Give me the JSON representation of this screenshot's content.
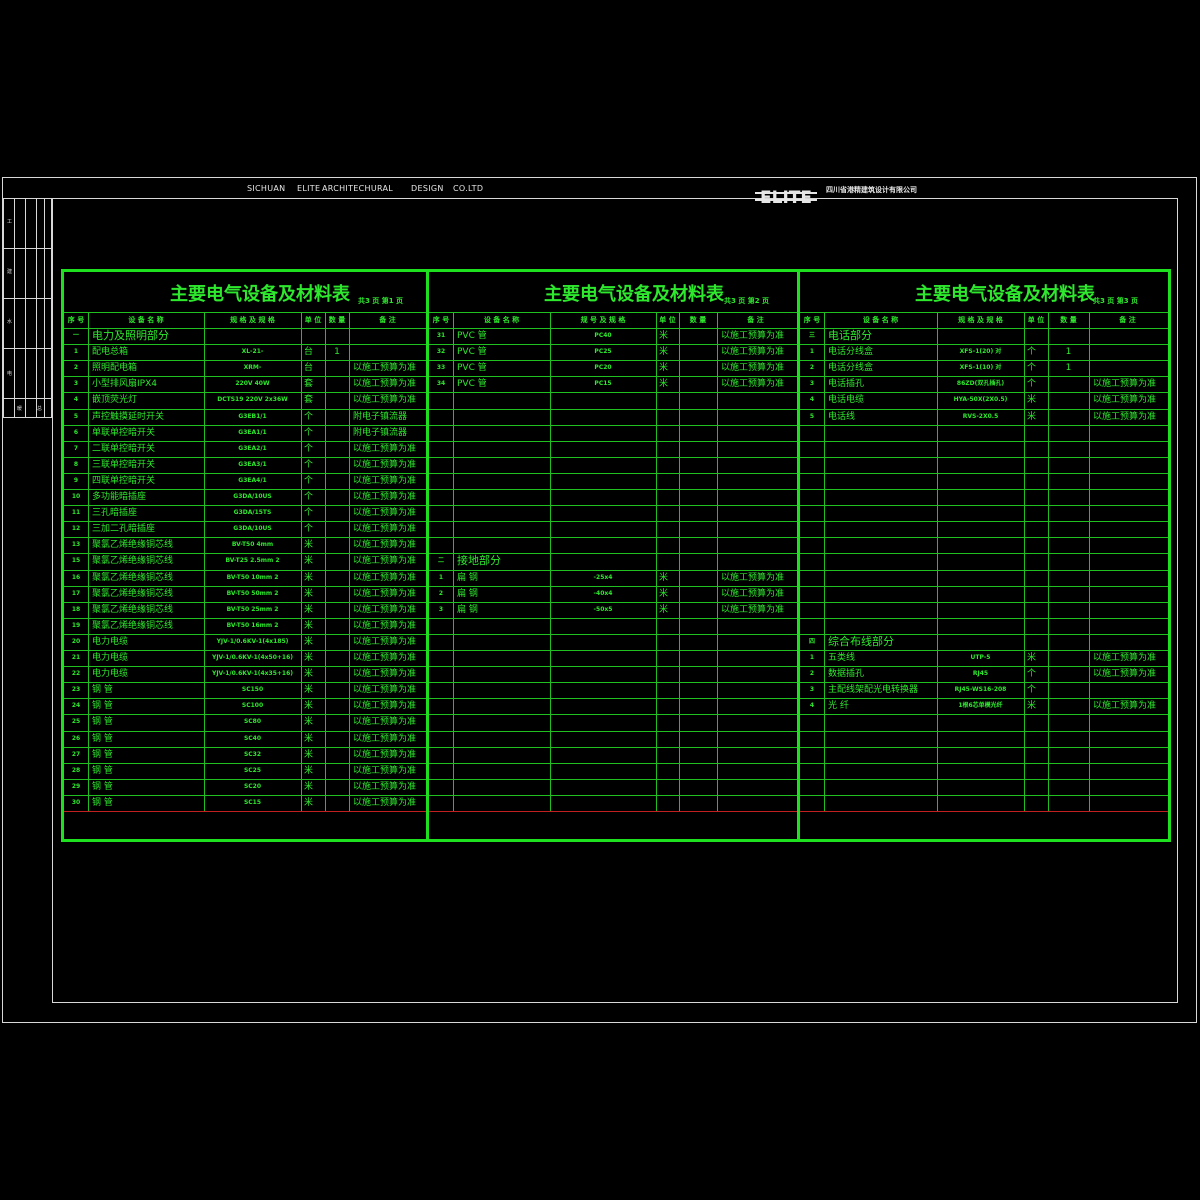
{
  "header": {
    "sichuan": "SICHUAN",
    "elite": "ELITE",
    "arch": "ARCHITECHURAL",
    "design": "DESIGN",
    "coltd": "CO.LTD",
    "logo": "ELITE",
    "company": "四川省港精建筑设计有限公司"
  },
  "strip_labels": [
    "工",
    "建",
    "水",
    "电",
    "暖",
    "总"
  ],
  "headers": {
    "seq": "序 号",
    "name": "设 备 名 称",
    "spec": "规 格 及 规 格",
    "unit": "单 位",
    "qty": "数 量",
    "note": "备 注",
    "spec2": "规 号 及 规 格"
  },
  "panels": [
    {
      "title": "主要电气设备及材料表",
      "page": "共3 页  第1 页",
      "rows": [
        [
          "一",
          "电力及照明部分",
          "",
          "",
          "",
          ""
        ],
        [
          "1",
          "配电总箱",
          "XL-21-",
          "台",
          "1",
          ""
        ],
        [
          "2",
          "照明配电箱",
          "XRM-",
          "台",
          "",
          "以施工预算为准"
        ],
        [
          "3",
          "小型排风扇IPX4",
          "220V 40W",
          "套",
          "",
          "以施工预算为准"
        ],
        [
          "4",
          "嵌顶荧光灯",
          "DCTS19 220V 2x36W",
          "套",
          "",
          "以施工预算为准"
        ],
        [
          "5",
          "声控触摸延时开关",
          "G3EB1/1",
          "个",
          "",
          "附电子镇流器"
        ],
        [
          "6",
          "单联单控暗开关",
          "G3EA1/1",
          "个",
          "",
          "附电子镇流器"
        ],
        [
          "7",
          "二联单控暗开关",
          "G3EA2/1",
          "个",
          "",
          "以施工预算为准"
        ],
        [
          "8",
          "三联单控暗开关",
          "G3EA3/1",
          "个",
          "",
          "以施工预算为准"
        ],
        [
          "9",
          "四联单控暗开关",
          "G3EA4/1",
          "个",
          "",
          "以施工预算为准"
        ],
        [
          "10",
          "多功能暗插座",
          "G3DA/10US",
          "个",
          "",
          "以施工预算为准"
        ],
        [
          "11",
          "三孔暗插座",
          "G3DA/15TS",
          "个",
          "",
          "以施工预算为准"
        ],
        [
          "12",
          "三加二孔暗插座",
          "G3DA/10US",
          "个",
          "",
          "以施工预算为准"
        ],
        [
          "13",
          "聚氯乙烯绝缘铜芯线",
          "BV-T50 4mm",
          "米",
          "",
          "以施工预算为准"
        ],
        [
          "15",
          "聚氯乙烯绝缘铜芯线",
          "BV-T25 2.5mm 2",
          "米",
          "",
          "以施工预算为准"
        ],
        [
          "16",
          "聚氯乙烯绝缘铜芯线",
          "BV-T50 10mm 2",
          "米",
          "",
          "以施工预算为准"
        ],
        [
          "17",
          "聚氯乙烯绝缘铜芯线",
          "BV-T50 50mm 2",
          "米",
          "",
          "以施工预算为准"
        ],
        [
          "18",
          "聚氯乙烯绝缘铜芯线",
          "BV-T50 25mm 2",
          "米",
          "",
          "以施工预算为准"
        ],
        [
          "19",
          "聚氯乙烯绝缘铜芯线",
          "BV-T50 16mm 2",
          "米",
          "",
          "以施工预算为准"
        ],
        [
          "20",
          "电力电缆",
          "YJV-1/0.6KV-1(4x185)",
          "米",
          "",
          "以施工预算为准"
        ],
        [
          "21",
          "电力电缆",
          "YJV-1/0.6KV-1(4x50+16)",
          "米",
          "",
          "以施工预算为准"
        ],
        [
          "22",
          "电力电缆",
          "YJV-1/0.6KV-1(4x35+16)",
          "米",
          "",
          "以施工预算为准"
        ],
        [
          "23",
          "钢 管",
          "SC150",
          "米",
          "",
          "以施工预算为准"
        ],
        [
          "24",
          "钢 管",
          "SC100",
          "米",
          "",
          "以施工预算为准"
        ],
        [
          "25",
          "钢 管",
          "SC80",
          "米",
          "",
          "以施工预算为准"
        ],
        [
          "26",
          "钢 管",
          "SC40",
          "米",
          "",
          "以施工预算为准"
        ],
        [
          "27",
          "钢 管",
          "SC32",
          "米",
          "",
          "以施工预算为准"
        ],
        [
          "28",
          "钢 管",
          "SC25",
          "米",
          "",
          "以施工预算为准"
        ],
        [
          "29",
          "钢 管",
          "SC20",
          "米",
          "",
          "以施工预算为准"
        ],
        [
          "30",
          "钢 管",
          "SC15",
          "米",
          "",
          "以施工预算为准"
        ]
      ]
    },
    {
      "title": "主要电气设备及材料表",
      "page": "共3 页  第2 页",
      "rows": [
        [
          "31",
          "PVC 管",
          "PC40",
          "米",
          "",
          "以施工预算为准"
        ],
        [
          "32",
          "PVC 管",
          "PC25",
          "米",
          "",
          "以施工预算为准"
        ],
        [
          "33",
          "PVC 管",
          "PC20",
          "米",
          "",
          "以施工预算为准"
        ],
        [
          "34",
          "PVC 管",
          "PC15",
          "米",
          "",
          "以施工预算为准"
        ],
        [
          "",
          "",
          "",
          "",
          "",
          ""
        ],
        [
          "",
          "",
          "",
          "",
          "",
          ""
        ],
        [
          "",
          "",
          "",
          "",
          "",
          ""
        ],
        [
          "",
          "",
          "",
          "",
          "",
          ""
        ],
        [
          "",
          "",
          "",
          "",
          "",
          ""
        ],
        [
          "",
          "",
          "",
          "",
          "",
          ""
        ],
        [
          "",
          "",
          "",
          "",
          "",
          ""
        ],
        [
          "",
          "",
          "",
          "",
          "",
          ""
        ],
        [
          "",
          "",
          "",
          "",
          "",
          ""
        ],
        [
          "",
          "",
          "",
          "",
          "",
          ""
        ],
        [
          "二",
          "接地部分",
          "",
          "",
          "",
          ""
        ],
        [
          "1",
          "扁 钢",
          "-25x4",
          "米",
          "",
          "以施工预算为准"
        ],
        [
          "2",
          "扁 钢",
          "-40x4",
          "米",
          "",
          "以施工预算为准"
        ],
        [
          "3",
          "扁 钢",
          "-50x5",
          "米",
          "",
          "以施工预算为准"
        ],
        [
          "",
          "",
          "",
          "",
          "",
          ""
        ],
        [
          "",
          "",
          "",
          "",
          "",
          ""
        ],
        [
          "",
          "",
          "",
          "",
          "",
          ""
        ],
        [
          "",
          "",
          "",
          "",
          "",
          ""
        ],
        [
          "",
          "",
          "",
          "",
          "",
          ""
        ],
        [
          "",
          "",
          "",
          "",
          "",
          ""
        ],
        [
          "",
          "",
          "",
          "",
          "",
          ""
        ],
        [
          "",
          "",
          "",
          "",
          "",
          ""
        ],
        [
          "",
          "",
          "",
          "",
          "",
          ""
        ],
        [
          "",
          "",
          "",
          "",
          "",
          ""
        ],
        [
          "",
          "",
          "",
          "",
          "",
          ""
        ],
        [
          "",
          "",
          "",
          "",
          "",
          ""
        ]
      ]
    },
    {
      "title": "主要电气设备及材料表",
      "page": "共3 页  第3 页",
      "rows": [
        [
          "三",
          "电话部分",
          "",
          "",
          "",
          ""
        ],
        [
          "1",
          "电话分线盒",
          "XFS-1(20) 对",
          "个",
          "1",
          ""
        ],
        [
          "2",
          "电话分线盒",
          "XFS-1(10) 对",
          "个",
          "1",
          ""
        ],
        [
          "3",
          "电话插孔",
          "86ZD(双孔插孔)",
          "个",
          "",
          "以施工预算为准"
        ],
        [
          "4",
          "电话电缆",
          "HYA-50X(2X0.5)",
          "米",
          "",
          "以施工预算为准"
        ],
        [
          "5",
          "电话线",
          "RVS-2X0.5",
          "米",
          "",
          "以施工预算为准"
        ],
        [
          "",
          "",
          "",
          "",
          "",
          ""
        ],
        [
          "",
          "",
          "",
          "",
          "",
          ""
        ],
        [
          "",
          "",
          "",
          "",
          "",
          ""
        ],
        [
          "",
          "",
          "",
          "",
          "",
          ""
        ],
        [
          "",
          "",
          "",
          "",
          "",
          ""
        ],
        [
          "",
          "",
          "",
          "",
          "",
          ""
        ],
        [
          "",
          "",
          "",
          "",
          "",
          ""
        ],
        [
          "",
          "",
          "",
          "",
          "",
          ""
        ],
        [
          "",
          "",
          "",
          "",
          "",
          ""
        ],
        [
          "",
          "",
          "",
          "",
          "",
          ""
        ],
        [
          "",
          "",
          "",
          "",
          "",
          ""
        ],
        [
          "",
          "",
          "",
          "",
          "",
          ""
        ],
        [
          "",
          "",
          "",
          "",
          "",
          ""
        ],
        [
          "四",
          "综合布线部分",
          "",
          "",
          "",
          ""
        ],
        [
          "1",
          "五类线",
          "UTP-5",
          "米",
          "",
          "以施工预算为准"
        ],
        [
          "2",
          "数据插孔",
          "RJ45",
          "个",
          "",
          "以施工预算为准"
        ],
        [
          "3",
          "主配线架配光电转换器",
          "RJ45-WS16-208",
          "个",
          "",
          ""
        ],
        [
          "4",
          "光 纤",
          "1根6芯单模光纤",
          "米",
          "",
          "以施工预算为准"
        ],
        [
          "",
          "",
          "",
          "",
          "",
          ""
        ],
        [
          "",
          "",
          "",
          "",
          "",
          ""
        ],
        [
          "",
          "",
          "",
          "",
          "",
          ""
        ],
        [
          "",
          "",
          "",
          "",
          "",
          ""
        ],
        [
          "",
          "",
          "",
          "",
          "",
          ""
        ],
        [
          "",
          "",
          "",
          "",
          "",
          ""
        ]
      ]
    }
  ],
  "colors": {
    "line": "#20c020",
    "text": "#2ee82e",
    "frame": "#d8d8d8",
    "redline": "#c02020"
  }
}
